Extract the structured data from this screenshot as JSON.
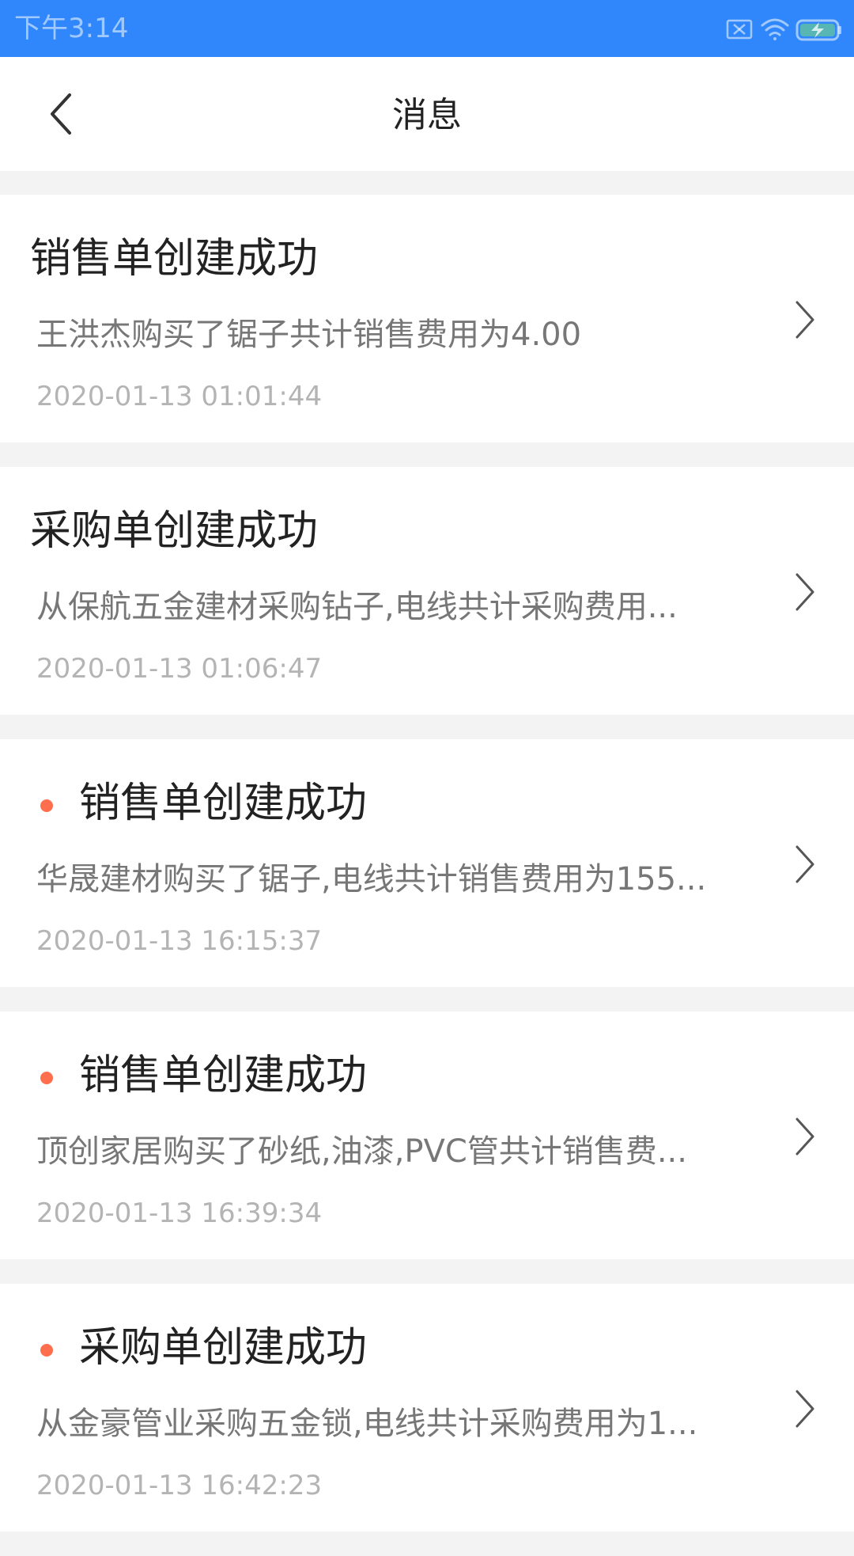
{
  "status_bar": {
    "time": "下午3:14",
    "icons": [
      "sim-off-icon",
      "wifi-icon",
      "battery-charging-icon"
    ],
    "color": "#2f87fb"
  },
  "header": {
    "title": "消息",
    "back_icon": "chevron-left-icon"
  },
  "messages": [
    {
      "title": "销售单创建成功",
      "desc": "王洪杰购买了锯子共计销售费用为4.00",
      "time": "2020-01-13 01:01:44",
      "unread": false
    },
    {
      "title": "采购单创建成功",
      "desc": "从保航五金建材采购钻子,电线共计采购费用...",
      "time": "2020-01-13 01:06:47",
      "unread": false
    },
    {
      "title": "销售单创建成功",
      "desc": "华晟建材购买了锯子,电线共计销售费用为155...",
      "time": "2020-01-13 16:15:37",
      "unread": true
    },
    {
      "title": "销售单创建成功",
      "desc": "顶创家居购买了砂纸,油漆,PVC管共计销售费...",
      "time": "2020-01-13 16:39:34",
      "unread": true
    },
    {
      "title": "采购单创建成功",
      "desc": "从金豪管业采购五金锁,电线共计采购费用为1...",
      "time": "2020-01-13 16:42:23",
      "unread": true
    }
  ],
  "colors": {
    "unread_dot": "#ff6f4e",
    "title_text": "#222222",
    "desc_text": "#777777",
    "time_text": "#b4b4b4"
  }
}
